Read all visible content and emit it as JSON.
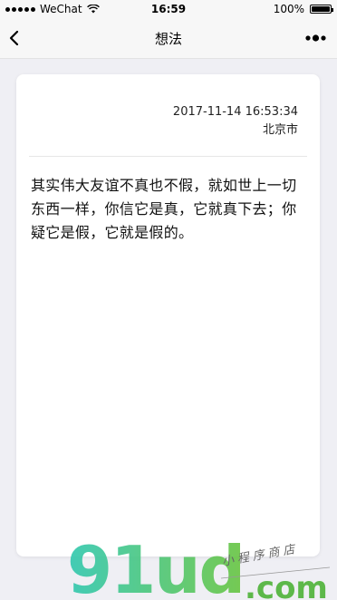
{
  "status_bar": {
    "carrier": "WeChat",
    "time": "16:59",
    "battery_percent": "100%",
    "battery_level": 1.0
  },
  "nav": {
    "title": "想法",
    "back_icon": "chevron-left-icon",
    "more_icon": "more-dots-icon"
  },
  "card": {
    "datetime": "2017-11-14 16:53:34",
    "location": "北京市",
    "content": "其实伟大友谊不真也不假，就如世上一切东西一样，你信它是真，它就真下去；你疑它是假，它就是假的。"
  },
  "watermark": {
    "brand": "91ud",
    "domain": ".com",
    "tagline": "小程序商店",
    "colors": {
      "green": "#6cc644",
      "teal": "#2ec4b6"
    }
  }
}
